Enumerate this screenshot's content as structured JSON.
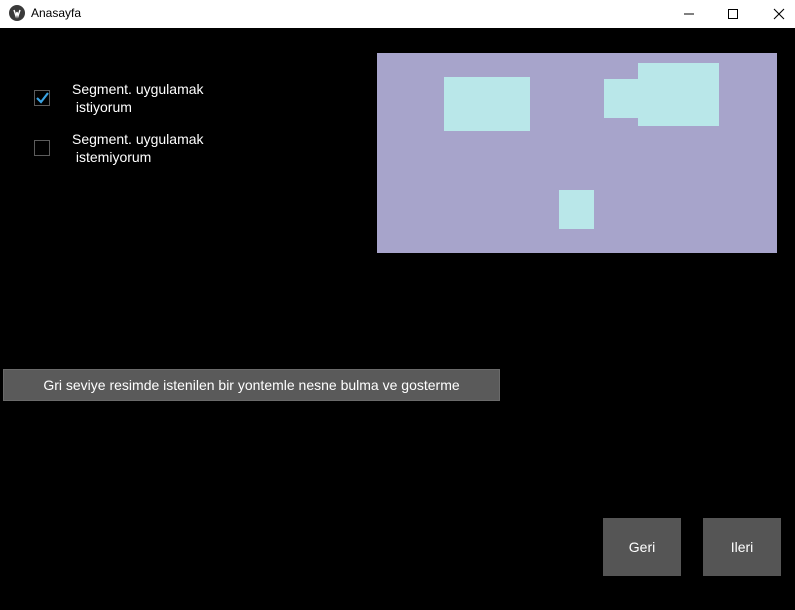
{
  "window": {
    "title": "Anasayfa"
  },
  "options": [
    {
      "label": "Segment. uygulamak\n istiyorum",
      "checked": true
    },
    {
      "label": "Segment. uygulamak\n istemiyorum",
      "checked": false
    }
  ],
  "process_button": "Gri seviye resimde istenilen bir yontemle nesne bulma ve gosterme",
  "nav": {
    "back": "Geri",
    "next": "Ileri"
  },
  "colors": {
    "canvas_bg": "#a7a4cb",
    "blob": "#b9e7e9",
    "check_accent": "#3aa3e3"
  }
}
